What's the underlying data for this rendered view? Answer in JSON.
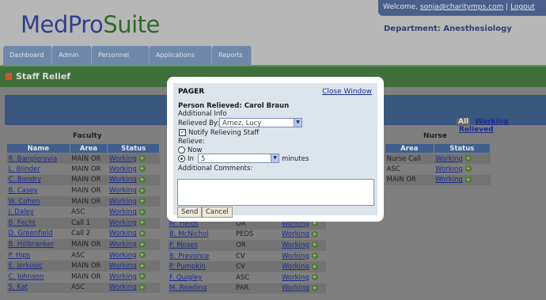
{
  "header": {
    "logo_part1": "MedPro",
    "logo_part2": "Suite",
    "welcome_prefix": "Welcome,",
    "welcome_user": "sonja@charitymps.com",
    "separator": "|",
    "logout": "Logout",
    "department": "Department: Anesthesiology"
  },
  "nav": [
    "Dashboard",
    "Admin",
    "Personnel",
    "Applications",
    "Reports"
  ],
  "page": {
    "title": "Staff Relief"
  },
  "filters": {
    "all": "All",
    "working": "Working",
    "relieved": "Relieved"
  },
  "faculty": {
    "title": "Faculty",
    "columns": [
      "Name",
      "Area",
      "Status"
    ],
    "rows": [
      {
        "name": "R. Bangleravia",
        "area": "MAIN OR",
        "status": "Working"
      },
      {
        "name": "L. Blinder",
        "area": "MAIN OR",
        "status": "Working"
      },
      {
        "name": "C. Bondry",
        "area": "MAIN OR",
        "status": "Working"
      },
      {
        "name": "B. Casey",
        "area": "MAIN OR",
        "status": "Working"
      },
      {
        "name": "W. Cohen",
        "area": "MAIN OR",
        "status": "Working"
      },
      {
        "name": "J. Daley",
        "area": "ASC",
        "status": "Working"
      },
      {
        "name": "B. Fecht",
        "area": "Call 1",
        "status": "Working"
      },
      {
        "name": "D. Greenfield",
        "area": "Call 2",
        "status": "Working"
      },
      {
        "name": "B. Hillbranker",
        "area": "MAIN OR",
        "status": "Working"
      },
      {
        "name": "P. Hips",
        "area": "ASC",
        "status": "Working"
      },
      {
        "name": "E. Jerkosic",
        "area": "MAIN OR",
        "status": "Working"
      },
      {
        "name": "C. Johnson",
        "area": "MAIN OR",
        "status": "Working"
      },
      {
        "name": "S. Kat",
        "area": "ASC",
        "status": "Working"
      }
    ]
  },
  "middle": {
    "rows": [
      {
        "name": "M. Fields",
        "area": "OR",
        "status": "Working"
      },
      {
        "name": "B. McNichol",
        "area": "PEDS",
        "status": "Working"
      },
      {
        "name": "P. Moses",
        "area": "OR",
        "status": "Working"
      },
      {
        "name": "B. Prevonce",
        "area": "CV",
        "status": "Working"
      },
      {
        "name": "P. Pumpkin",
        "area": "CV",
        "status": "Working"
      },
      {
        "name": "F. Quigley",
        "area": "ASC",
        "status": "Working"
      },
      {
        "name": "M. Roading",
        "area": "PAR",
        "status": "Working"
      }
    ]
  },
  "nurse": {
    "title": "Nurse",
    "columns": [
      "Area",
      "Status"
    ],
    "rows": [
      {
        "area": "Nurse Call",
        "status": "Working"
      },
      {
        "area": "ASC",
        "status": "Working"
      },
      {
        "area": "MAIN OR",
        "status": "Working"
      }
    ]
  },
  "pager": {
    "title": "PAGER",
    "close": "Close Window",
    "person_relieved": "Person Relieved: Carol Braun",
    "additional_info": "Additional Info",
    "relieved_by_label": "Relieved By:",
    "relieved_by_value": "Arnez, Lucy",
    "notify_label": "Notify Relieving Staff",
    "notify_checked": true,
    "relieve_label": "Relieve:",
    "now_label": "Now",
    "in_label": "In",
    "in_value": "5",
    "minutes_label": "minutes",
    "comments_label": "Additional Comments:",
    "comments_value": "",
    "send": "Send",
    "cancel": "Cancel"
  }
}
